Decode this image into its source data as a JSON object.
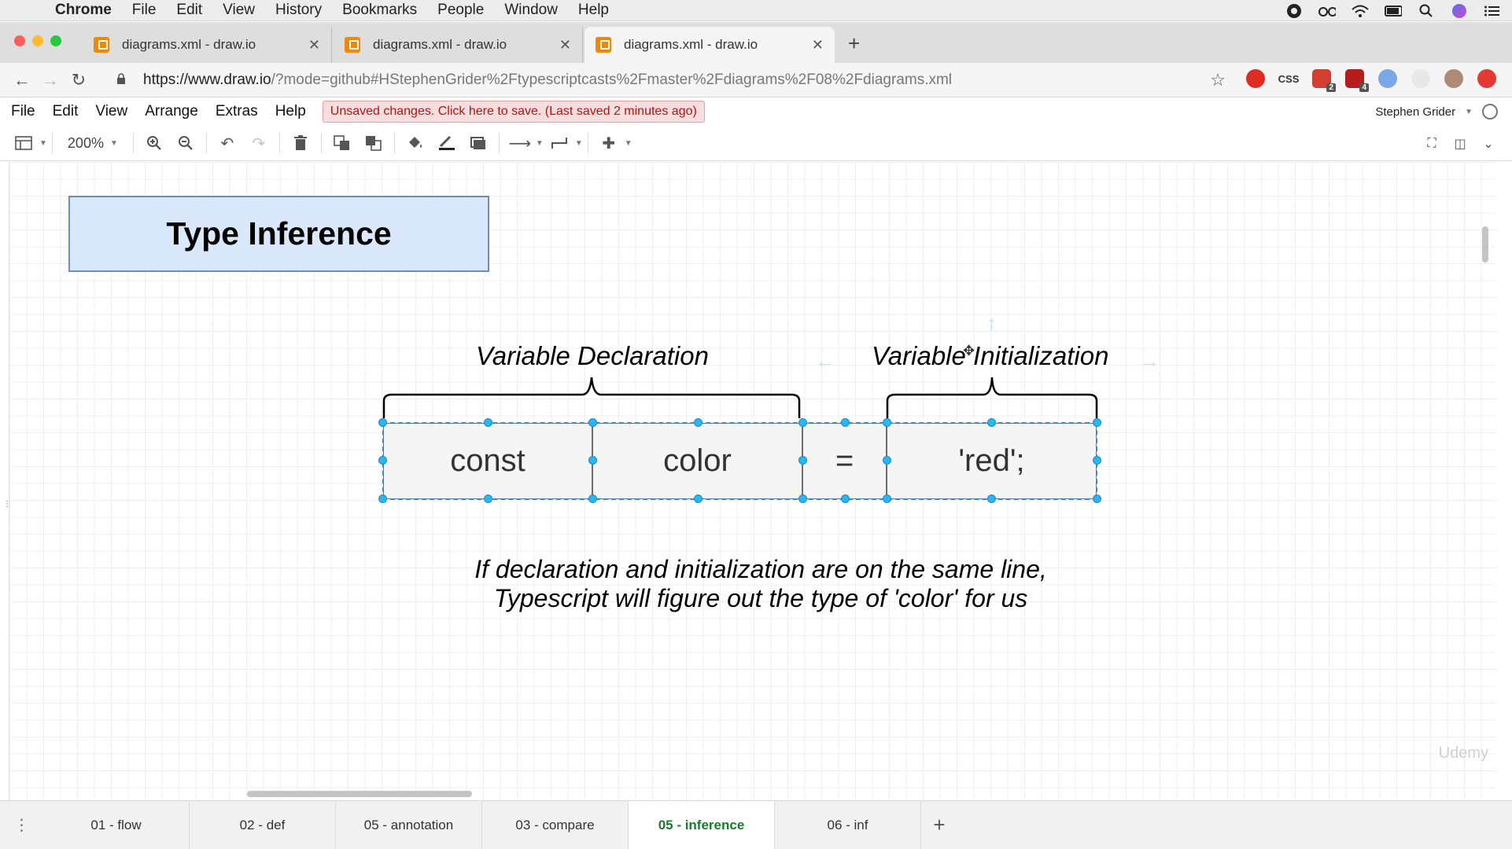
{
  "mac_menu": {
    "app": "Chrome",
    "items": [
      "File",
      "Edit",
      "View",
      "History",
      "Bookmarks",
      "People",
      "Window",
      "Help"
    ]
  },
  "browser": {
    "tabs": [
      {
        "title": "diagrams.xml - draw.io",
        "active": false
      },
      {
        "title": "diagrams.xml - draw.io",
        "active": false
      },
      {
        "title": "diagrams.xml - draw.io",
        "active": true
      }
    ],
    "url_host": "https://www.draw.io",
    "url_rest": "/?mode=github#HStephenGrider%2Ftypescriptcasts%2Fmaster%2Fdiagrams%2F08%2Fdiagrams.xml",
    "ext_badges": [
      "2",
      "4"
    ],
    "css_ext_label": "CSS"
  },
  "drawio": {
    "menu": [
      "File",
      "Edit",
      "View",
      "Arrange",
      "Extras",
      "Help"
    ],
    "unsaved_notice": "Unsaved changes. Click here to save. (Last saved 2 minutes ago)",
    "user_name": "Stephen Grider",
    "zoom": "200%"
  },
  "diagram": {
    "title": "Type Inference",
    "left_label": "Variable Declaration",
    "right_label": "Variable Initialization",
    "cells": [
      "const",
      "color",
      "=",
      "'red';"
    ],
    "note_line1": "If declaration and initialization are on the same line,",
    "note_line2": "Typescript will figure out the type of 'color' for us"
  },
  "page_tabs": [
    {
      "label": "01 - flow",
      "active": false
    },
    {
      "label": "02 - def",
      "active": false
    },
    {
      "label": "05 - annotation",
      "active": false
    },
    {
      "label": "03 - compare",
      "active": false
    },
    {
      "label": "05 - inference",
      "active": true
    },
    {
      "label": "06 - inf",
      "active": false
    }
  ],
  "watermark": "Udemy",
  "colors": {
    "title_fill": "#dae8fc",
    "title_stroke": "#6c8ebf",
    "selection": "#29b6f2",
    "active_page_tab": "#1a7a2e",
    "unsaved_bg": "#f6dede"
  }
}
